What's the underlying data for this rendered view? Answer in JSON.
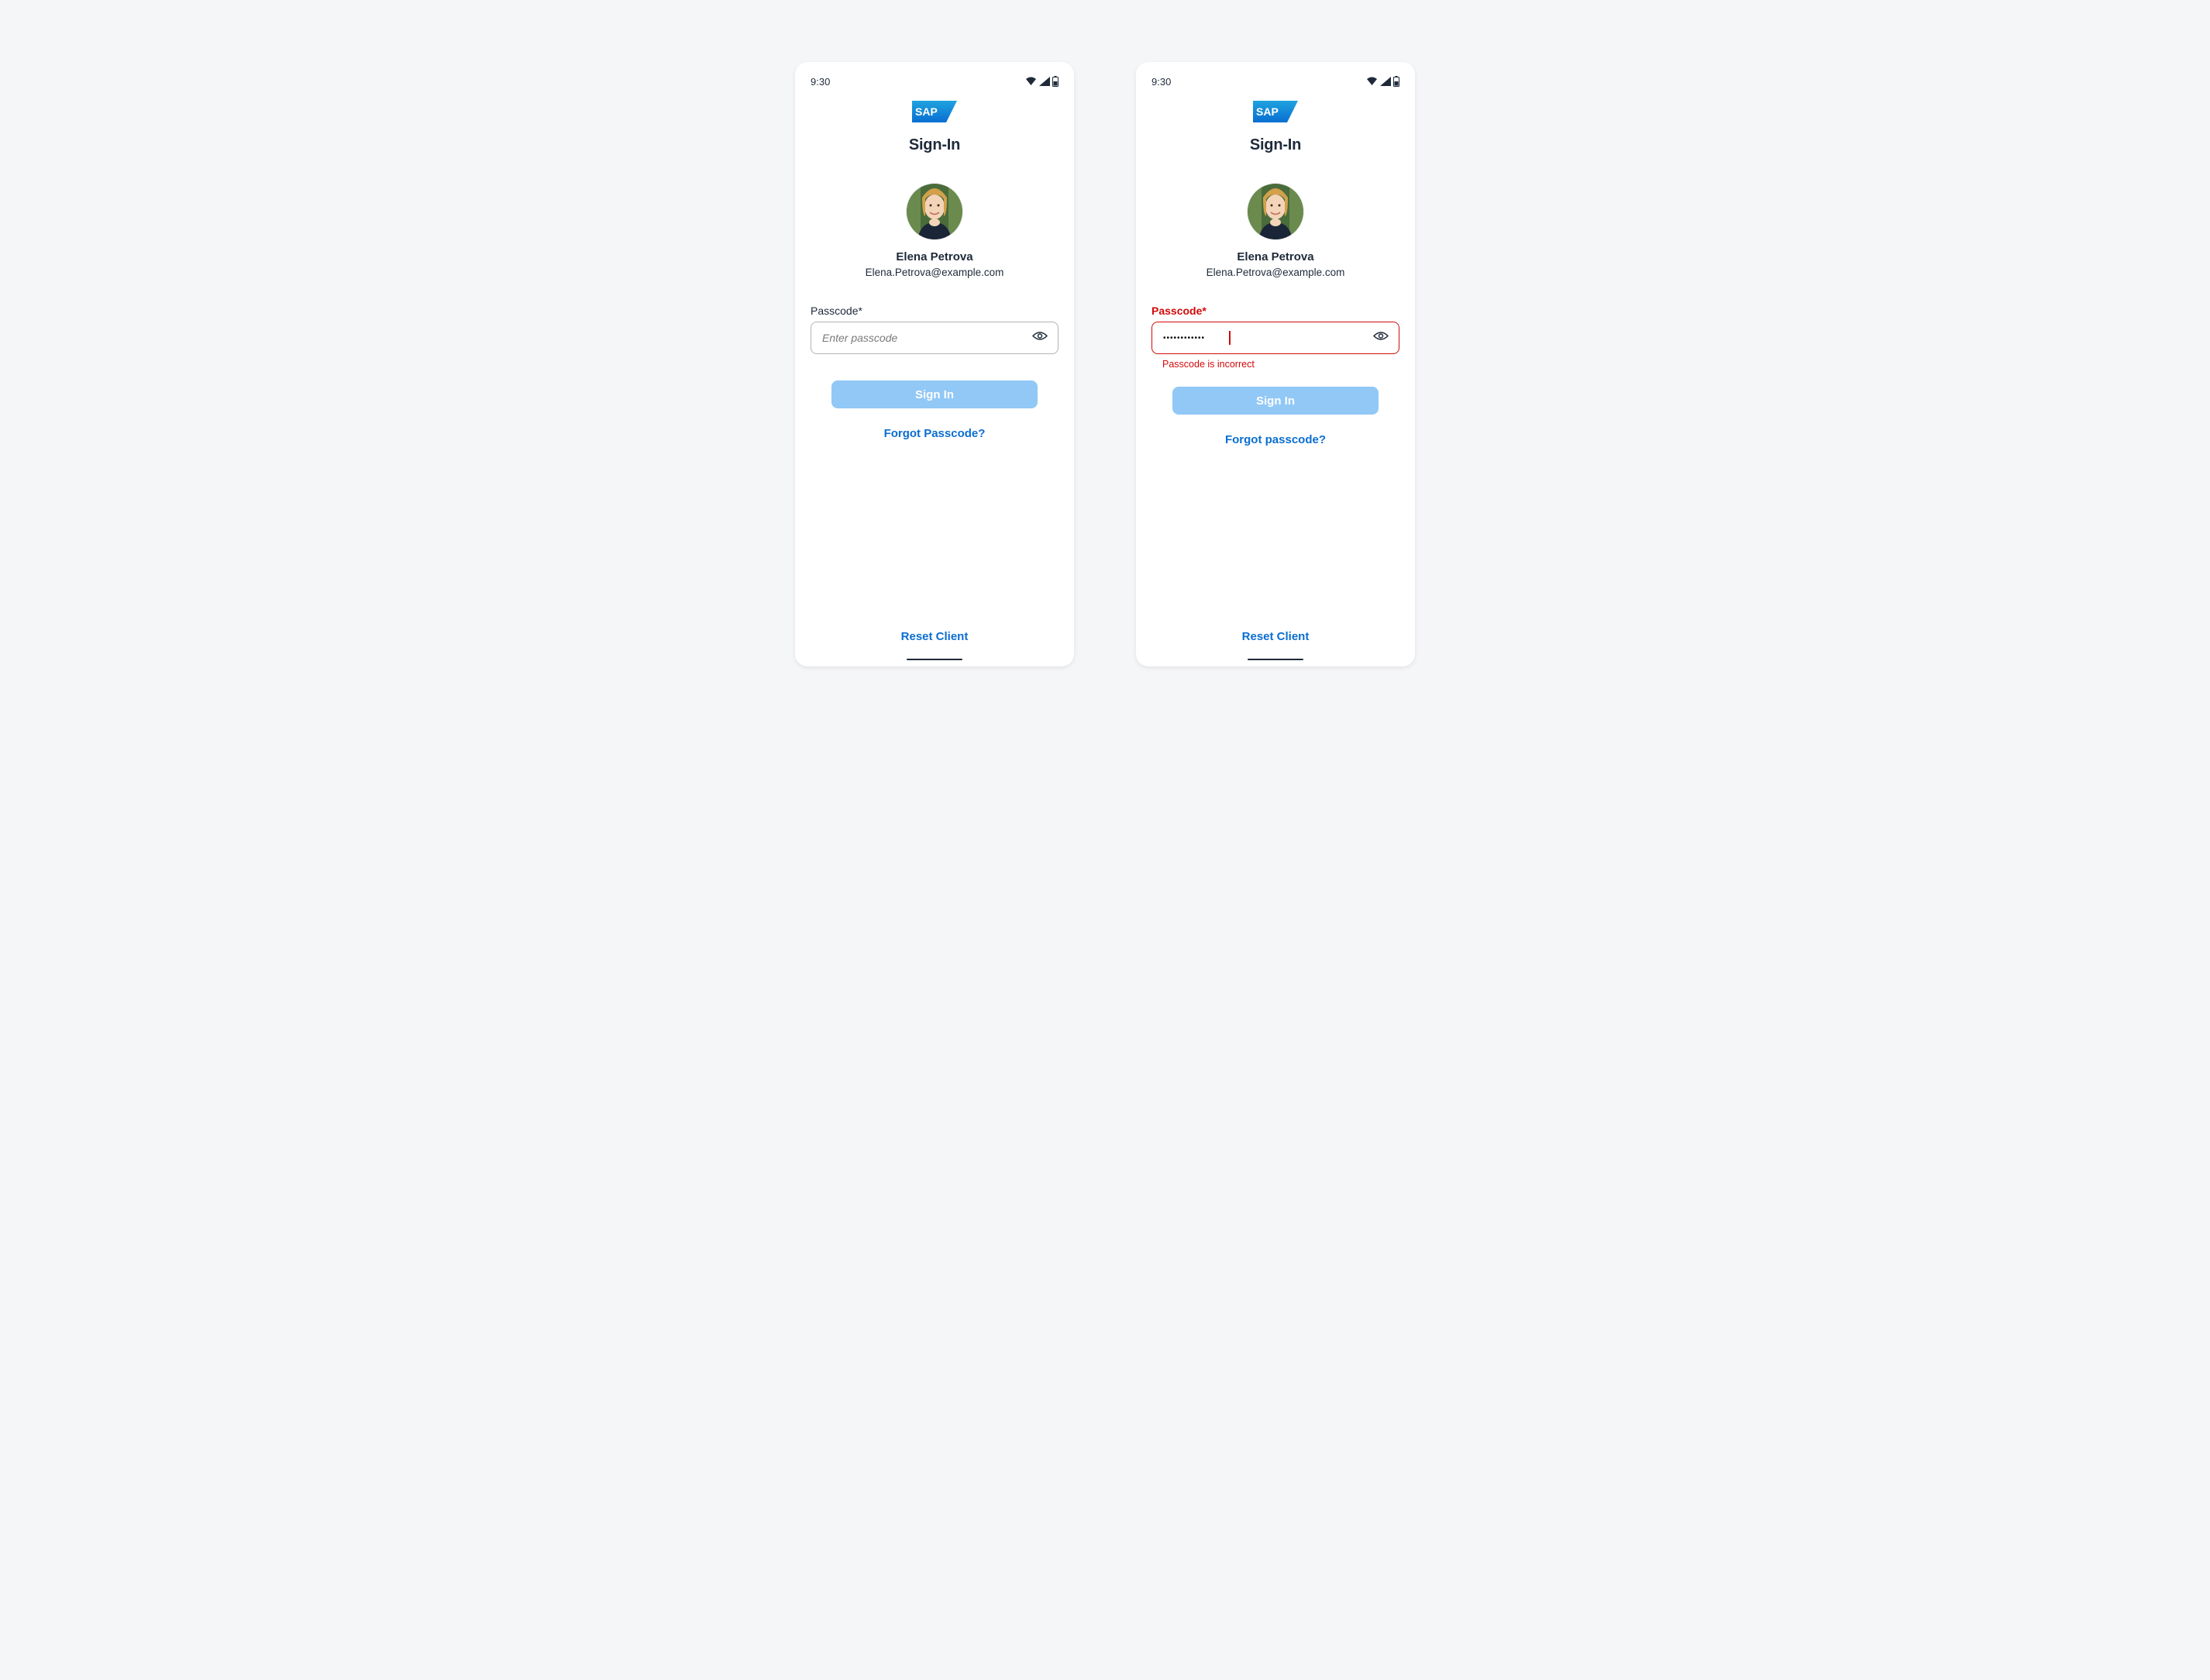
{
  "status": {
    "time": "9:30"
  },
  "brand": {
    "logo_text": "SAP"
  },
  "heading": "Sign-In",
  "user": {
    "name": "Elena Petrova",
    "email": "Elena.Petrova@example.com"
  },
  "screen1": {
    "passcode_label": "Passcode*",
    "passcode_placeholder": "Enter passcode",
    "passcode_value": "",
    "signin_label": "Sign In",
    "forgot_label": "Forgot Passcode?",
    "reset_label": "Reset Client"
  },
  "screen2": {
    "passcode_label": "Passcode*",
    "passcode_value": "••••••••••••",
    "error_message": "Passcode is incorrect",
    "signin_label": "Sign In",
    "forgot_label": "Forgot passcode?",
    "reset_label": "Reset Client"
  }
}
